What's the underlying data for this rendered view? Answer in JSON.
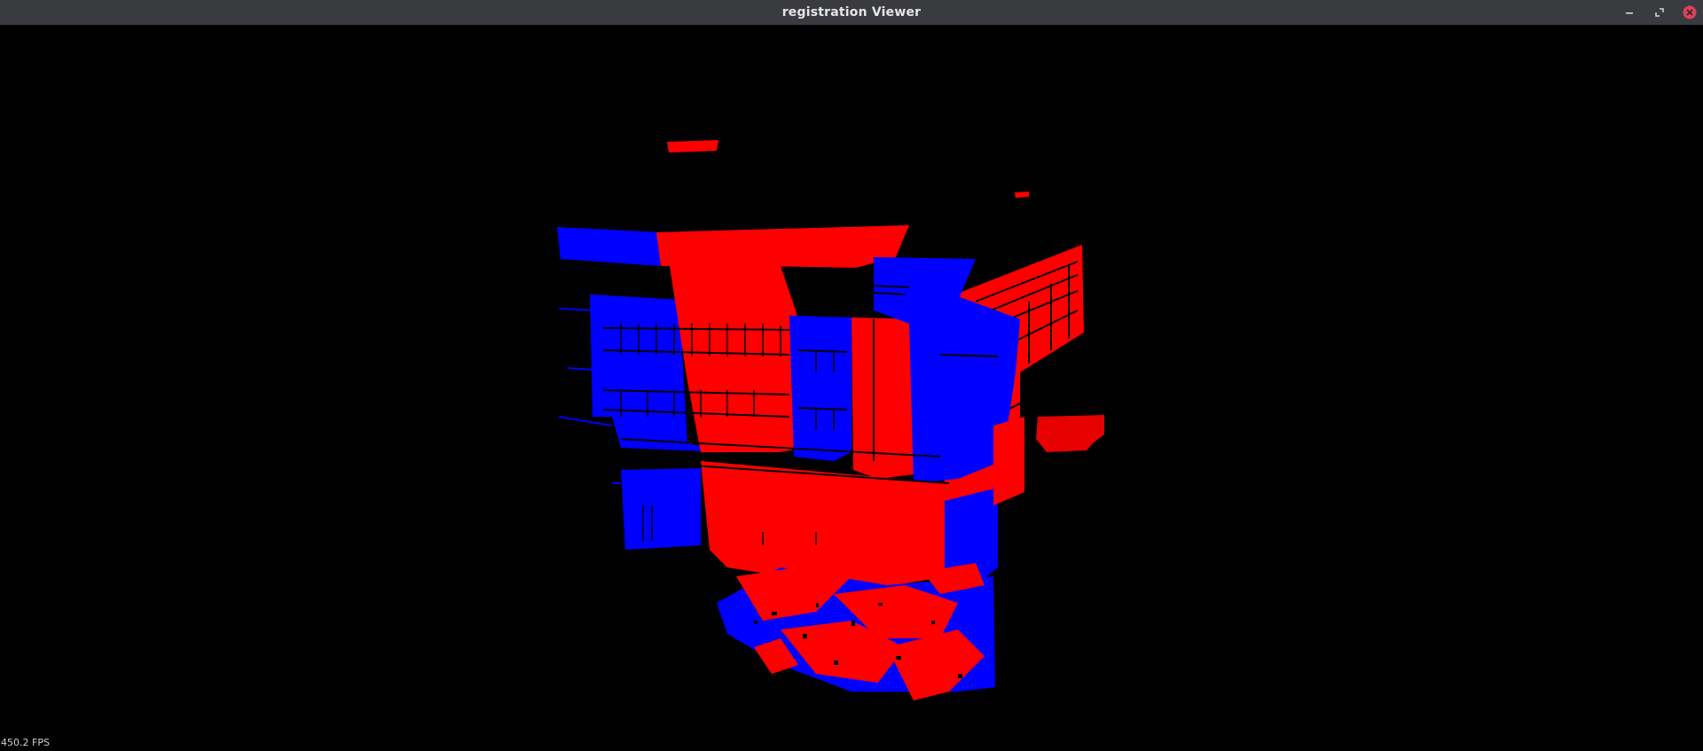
{
  "window": {
    "title": "registration Viewer",
    "controls": {
      "minimize_icon": "minimize-icon",
      "maximize_icon": "maximize-icon",
      "close_icon": "close-icon"
    }
  },
  "viewer": {
    "background_color": "#000000",
    "point_colors": {
      "source": "#ff0000",
      "target": "#0000ff"
    },
    "fps_text": "450.2 FPS"
  }
}
